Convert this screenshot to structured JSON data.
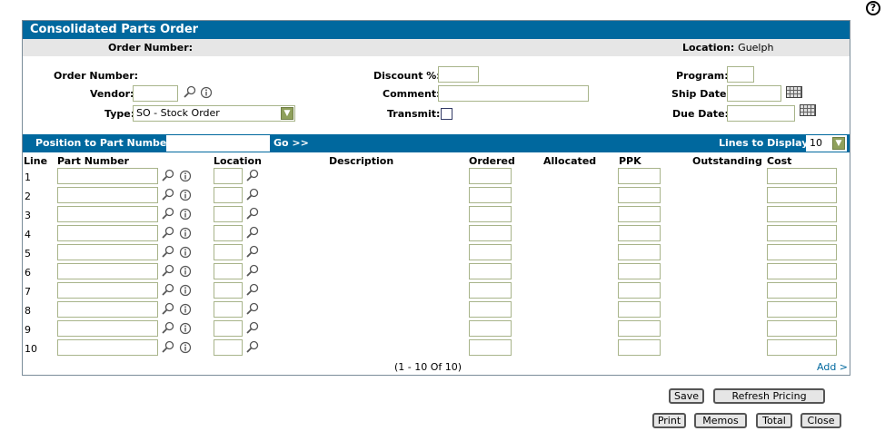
{
  "help": {
    "label": "?"
  },
  "header": {
    "title": "Consolidated Parts Order",
    "order_number_label": "Order Number:",
    "location_label": "Location:",
    "location_value": "Guelph"
  },
  "form": {
    "order_number_label": "Order Number:",
    "vendor_label": "Vendor:",
    "type_label": "Type:",
    "type_value": "SO - Stock Order",
    "discount_label": "Discount %:",
    "comment_label": "Comment:",
    "transmit_label": "Transmit:",
    "program_label": "Program:",
    "ship_date_label": "Ship Date:",
    "due_date_label": "Due Date:"
  },
  "position": {
    "label": "Position to Part Number:",
    "go_label": "Go >>",
    "lines_label": "Lines to Display:",
    "lines_value": "10"
  },
  "grid": {
    "columns": [
      "Line",
      "Part Number",
      "Location",
      "Description",
      "Ordered",
      "Allocated",
      "PPK",
      "Outstanding",
      "Cost"
    ],
    "rows": [
      "1",
      "2",
      "3",
      "4",
      "5",
      "6",
      "7",
      "8",
      "9",
      "10"
    ]
  },
  "pager": {
    "text": "(1 - 10 Of 10)",
    "add_label": "Add >"
  },
  "buttons": {
    "save": "Save",
    "refresh": "Refresh Pricing",
    "print": "Print",
    "memos": "Memos",
    "total": "Total",
    "close": "Close"
  },
  "colors": {
    "accent": "#00689e",
    "info_bar": "#e6e6e6",
    "input_border": "#a8b48a"
  }
}
